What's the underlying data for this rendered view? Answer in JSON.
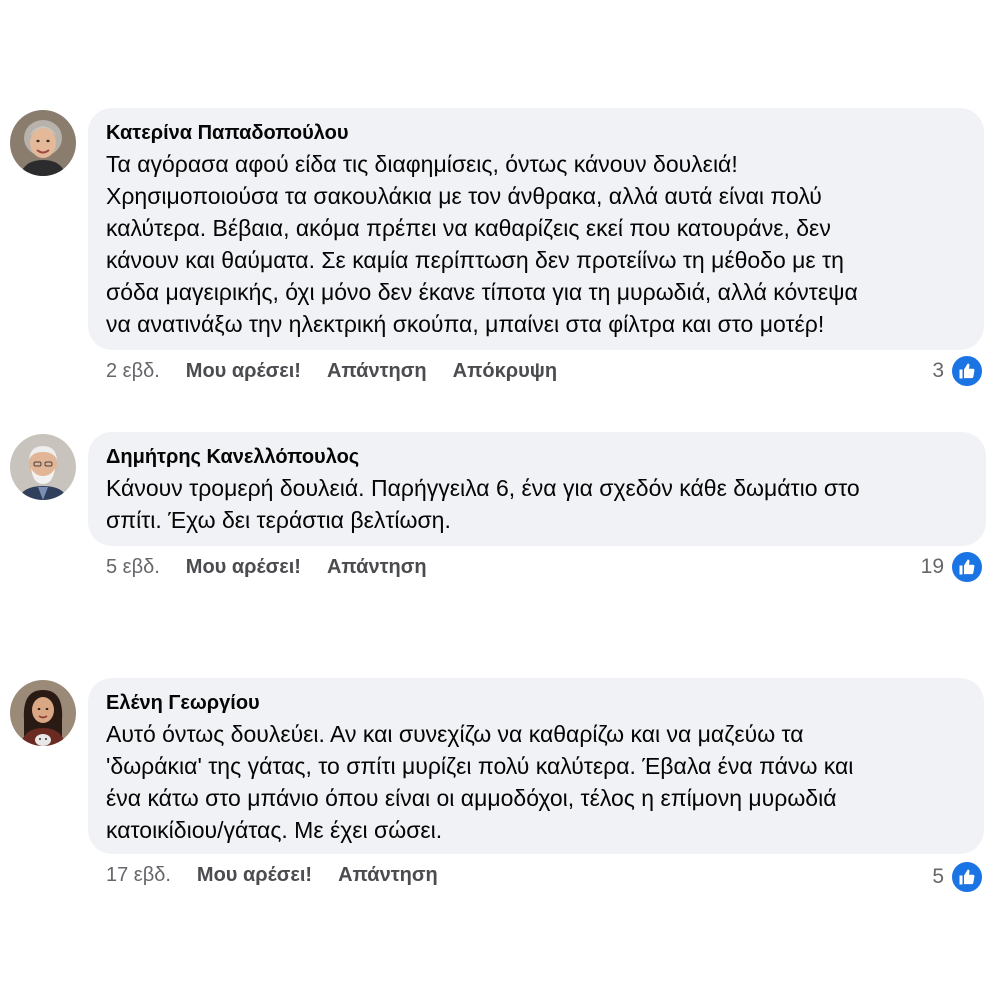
{
  "comments": [
    {
      "author": "Κατερίνα Παπαδοπούλου",
      "avatar_icon": "elderly-woman-avatar",
      "text": "Τα αγόρασα αφού είδα τις διαφημίσεις, όντως κάνουν δουλειά!\nΧρησιμοποιούσα τα σακουλάκια με τον άνθρακα, αλλά αυτά είναι πολύ\nκαλύτερα. Βέβαια, ακόμα πρέπει να καθαρίζεις εκεί που κατουράνε, δεν\nκάνουν και θαύματα. Σε καμία περίπτωση δεν προτείίνω τη μέθοδο με τη\nσόδα μαγειρικής, όχι μόνο δεν έκανε τίποτα για τη μυρωδιά, αλλά κόντεψα\nνα ανατινάξω την ηλεκτρική σκούπα, μπαίνει στα φίλτρα και στο μοτέρ!",
      "time": "2 εβδ.",
      "like_label": "Μου αρέσει!",
      "reply_label": "Απάντηση",
      "hide_label": "Απόκρυψη",
      "reaction_count": "3",
      "reaction_icon": "like-icon"
    },
    {
      "author": "Δημήτρης Κανελλόπουλος",
      "avatar_icon": "elderly-man-avatar",
      "text": "Κάνουν τρομερή δουλειά. Παρήγγειλα 6, ένα για σχεδόν κάθε δωμάτιο στο\nσπίτι. Έχω δει τεράστια βελτίωση.",
      "time": "5 εβδ.",
      "like_label": "Μου αρέσει!",
      "reply_label": "Απάντηση",
      "reaction_count": "19",
      "reaction_icon": "like-icon"
    },
    {
      "author": "Ελένη Γεωργίου",
      "avatar_icon": "young-woman-avatar",
      "text": "Αυτό όντως δουλεύει. Αν και συνεχίζω να καθαρίζω και να μαζεύω τα\n'δωράκια' της γάτας, το σπίτι μυρίζει πολύ καλύτερα. Έβαλα ένα πάνω και\nένα κάτω στο μπάνιο όπου είναι οι αμμοδόχοι, τέλος η επίμονη μυρωδιά\nκατοικίδιου/γάτας. Με έχει σώσει.",
      "time": "17 εβδ.",
      "like_label": "Μου αρέσει!",
      "reply_label": "Απάντηση",
      "reaction_count": "5",
      "reaction_icon": "like-icon"
    }
  ],
  "colors": {
    "bubble_bg": "#f0f2f5",
    "like_blue": "#1b74e4",
    "meta_gray": "#65676b"
  }
}
